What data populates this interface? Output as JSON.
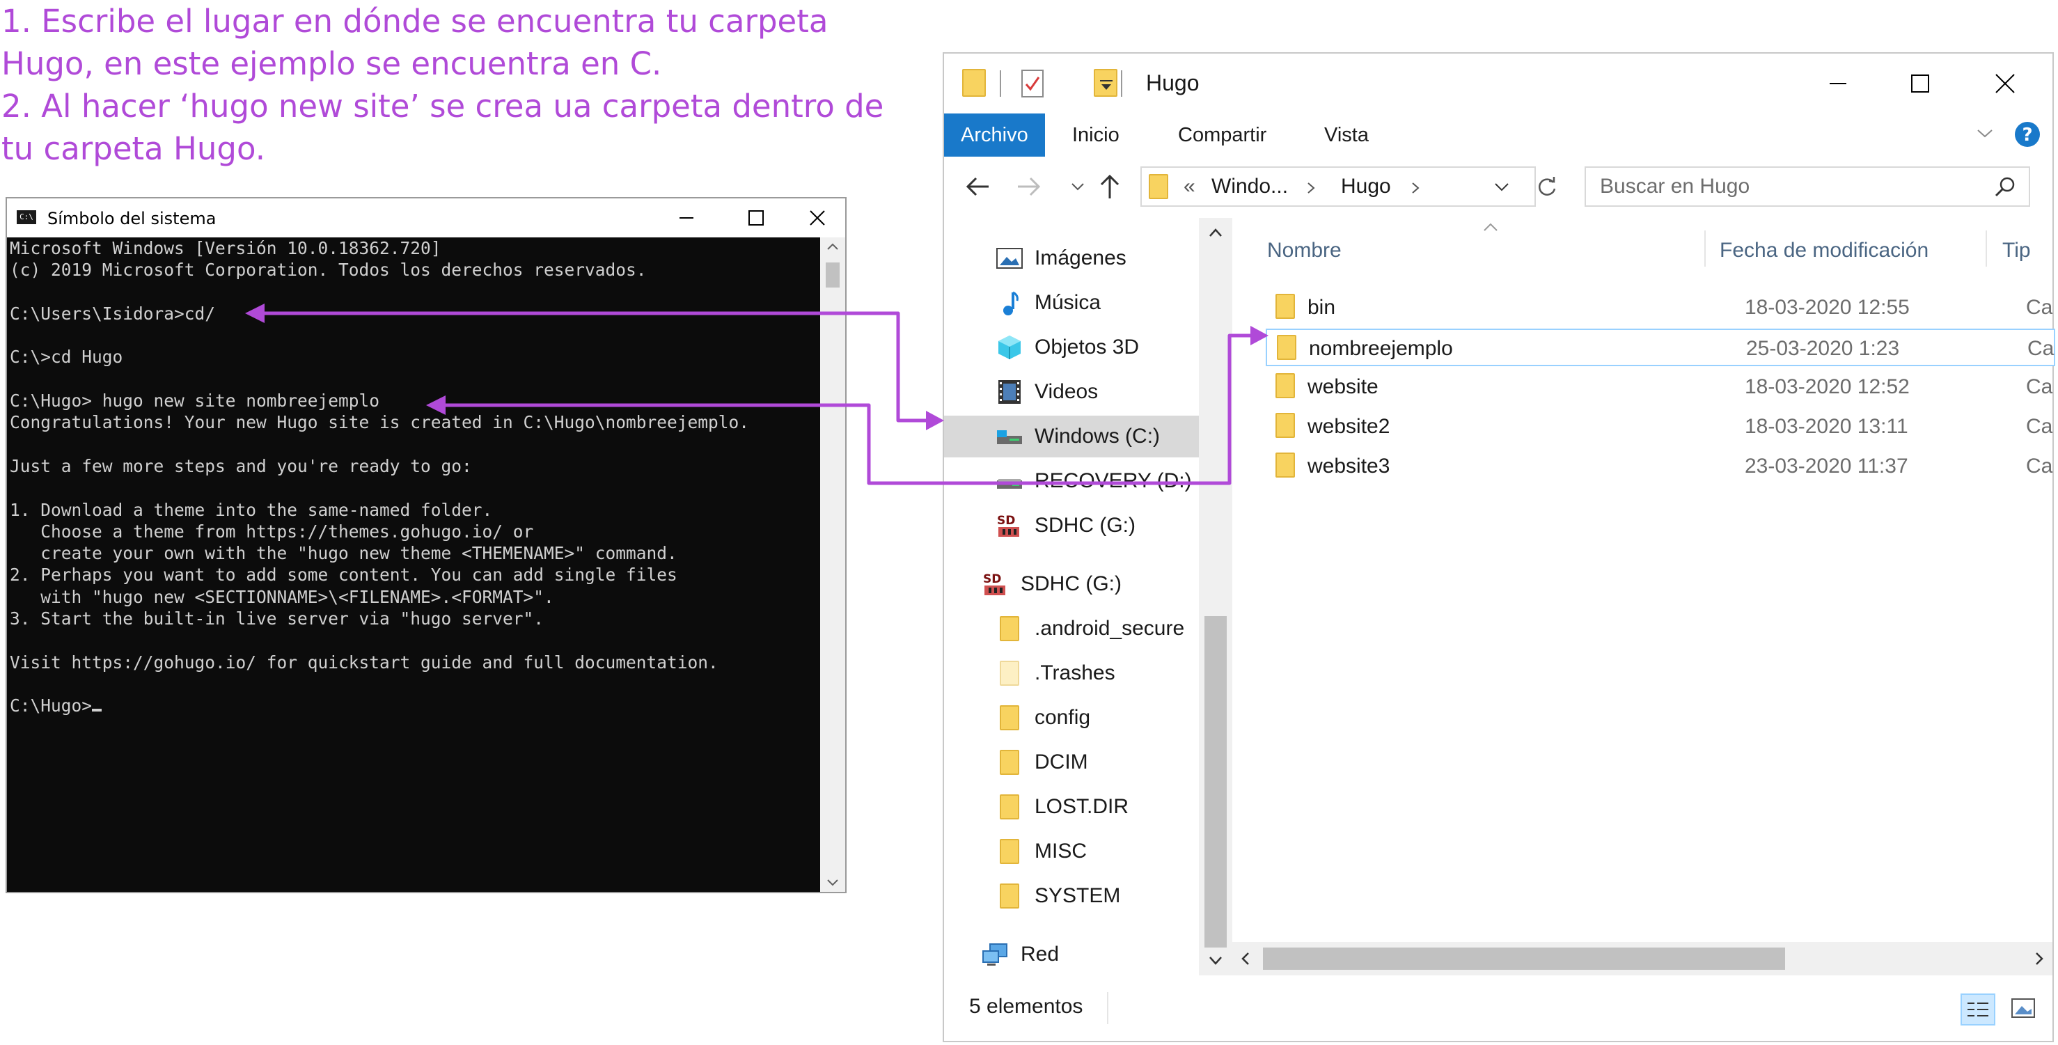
{
  "instructions": {
    "lines": [
      "1. Escribe el lugar en dónde se encuentra tu carpeta",
      "Hugo, en este ejemplo se encuentra en C.",
      "2. Al hacer  ‘hugo new site’ se crea ua carpeta dentro de",
      "tu carpeta Hugo."
    ]
  },
  "cmd": {
    "title": "Símbolo del sistema",
    "icon_label": "C:\\",
    "lines": [
      "Microsoft Windows [Versión 10.0.18362.720]",
      "(c) 2019 Microsoft Corporation. Todos los derechos reservados.",
      "",
      "C:\\Users\\Isidora>cd/",
      "",
      "C:\\>cd Hugo",
      "",
      "C:\\Hugo> hugo new site nombreejemplo",
      "Congratulations! Your new Hugo site is created in C:\\Hugo\\nombreejemplo.",
      "",
      "Just a few more steps and you're ready to go:",
      "",
      "1. Download a theme into the same-named folder.",
      "   Choose a theme from https://themes.gohugo.io/ or",
      "   create your own with the \"hugo new theme <THEMENAME>\" command.",
      "2. Perhaps you want to add some content. You can add single files",
      "   with \"hugo new <SECTIONNAME>\\<FILENAME>.<FORMAT>\".",
      "3. Start the built-in live server via \"hugo server\".",
      "",
      "Visit https://gohugo.io/ for quickstart guide and full documentation.",
      ""
    ],
    "prompt": "C:\\Hugo>"
  },
  "explorer": {
    "title": "Hugo",
    "tabs": [
      "Archivo",
      "Inicio",
      "Compartir",
      "Vista"
    ],
    "address": {
      "prefix": "«",
      "segments": [
        "Windo...",
        "Hugo"
      ]
    },
    "search_placeholder": "Buscar en Hugo",
    "nav": [
      {
        "label": "Imágenes",
        "icon": "pictures-icon"
      },
      {
        "label": "Música",
        "icon": "music-icon"
      },
      {
        "label": "Objetos 3D",
        "icon": "objects-3d-icon"
      },
      {
        "label": "Videos",
        "icon": "videos-icon"
      },
      {
        "label": "Windows (C:)",
        "icon": "drive-c-icon",
        "selected": true
      },
      {
        "label": "RECOVERY (D:)",
        "icon": "drive-icon"
      },
      {
        "label": "SDHC (G:)",
        "icon": "sd-card-icon"
      },
      {
        "label": "SDHC (G:)",
        "icon": "sd-card-icon"
      },
      {
        "label": ".android_secure",
        "icon": "folder-icon"
      },
      {
        "label": ".Trashes",
        "icon": "folder-icon"
      },
      {
        "label": "config",
        "icon": "folder-icon"
      },
      {
        "label": "DCIM",
        "icon": "folder-icon"
      },
      {
        "label": "LOST.DIR",
        "icon": "folder-icon"
      },
      {
        "label": "MISC",
        "icon": "folder-icon"
      },
      {
        "label": "SYSTEM",
        "icon": "folder-icon"
      },
      {
        "label": "Red",
        "icon": "network-icon"
      }
    ],
    "columns": [
      "Nombre",
      "Fecha de modificación",
      "Tip"
    ],
    "files": [
      {
        "name": "bin",
        "date": "18-03-2020 12:55",
        "type": "Ca"
      },
      {
        "name": "nombreejemplo",
        "date": "25-03-2020 1:23",
        "type": "Ca"
      },
      {
        "name": "website",
        "date": "18-03-2020 12:52",
        "type": "Ca"
      },
      {
        "name": "website2",
        "date": "18-03-2020 13:11",
        "type": "Ca"
      },
      {
        "name": "website3",
        "date": "23-03-2020 11:37",
        "type": "Ca"
      }
    ],
    "status": "5 elementos"
  },
  "colors": {
    "annotation": "#b04ad8",
    "ribbon_file_tab": "#1979ca",
    "folder": "#f8d360"
  }
}
